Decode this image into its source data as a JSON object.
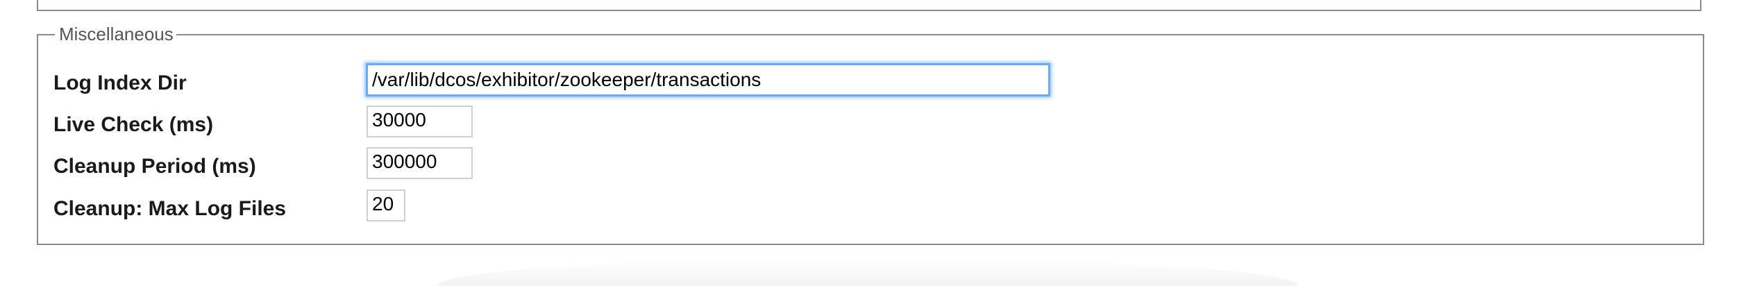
{
  "miscellaneous": {
    "legend": "Miscellaneous",
    "fields": [
      {
        "label": "Log Index Dir",
        "value": "/var/lib/dcos/exhibitor/zookeeper/transactions",
        "focused": true
      },
      {
        "label": "Live Check (ms)",
        "value": "30000",
        "focused": false
      },
      {
        "label": "Cleanup Period (ms)",
        "value": "300000",
        "focused": false
      },
      {
        "label": "Cleanup: Max Log Files",
        "value": "20",
        "focused": false
      }
    ]
  },
  "colors": {
    "focus_ring": "#6aa9f5",
    "fieldset_border": "#8a8a8a",
    "legend_text": "#555555"
  }
}
